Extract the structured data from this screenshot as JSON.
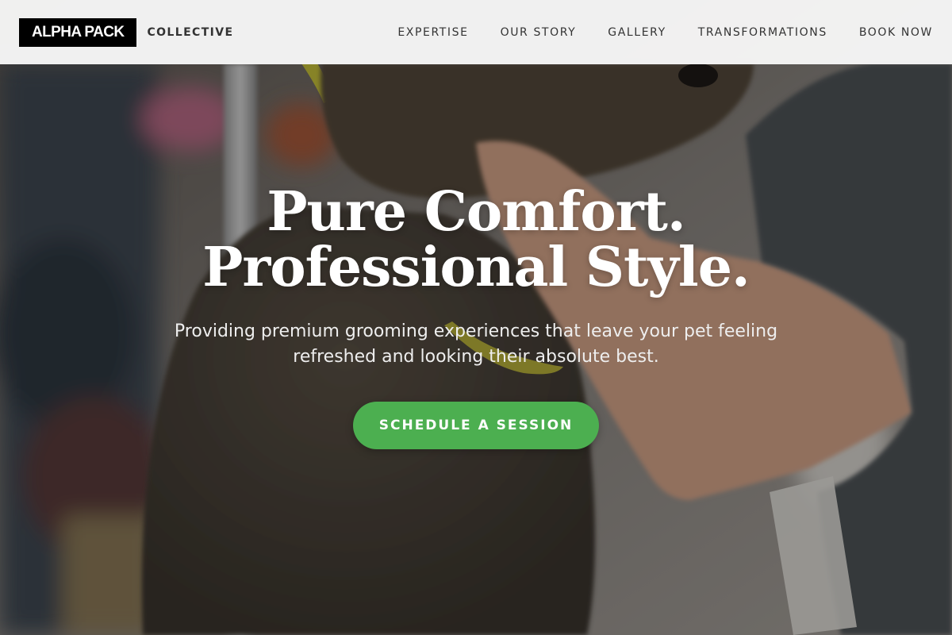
{
  "header": {
    "logo_text": "ALPHA PACK",
    "logo_subtext": "COLLECTIVE",
    "nav": [
      {
        "label": "EXPERTISE"
      },
      {
        "label": "OUR STORY"
      },
      {
        "label": "GALLERY"
      },
      {
        "label": "TRANSFORMATIONS"
      },
      {
        "label": "BOOK NOW"
      }
    ]
  },
  "hero": {
    "title_line1": "Pure Comfort.",
    "title_line2": "Professional Style.",
    "subtitle": "Providing premium grooming experiences that leave your pet feeling refreshed and looking their absolute best.",
    "cta_label": "SCHEDULE A SESSION",
    "background_image": "poodle-grooming-photo"
  },
  "colors": {
    "accent": "#4caf50",
    "header_bg": "#f6f6f6",
    "logo_bg": "#000000"
  }
}
